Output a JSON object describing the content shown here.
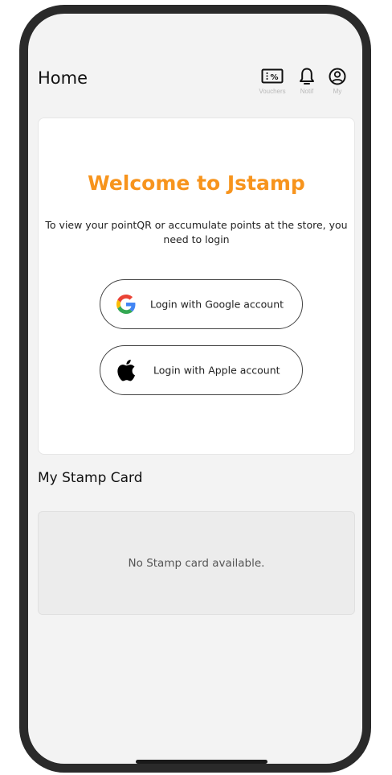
{
  "header": {
    "title": "Home",
    "actions": [
      {
        "label": "Vouchers",
        "icon": "voucher-percent-icon"
      },
      {
        "label": "Notif",
        "icon": "bell-icon"
      },
      {
        "label": "My",
        "icon": "user-circle-icon"
      }
    ]
  },
  "login_card": {
    "title": "Welcome to Jstamp",
    "message": "To view your pointQR or accumulate points at the store, you need to login",
    "google_button": {
      "label": "Login with Google account",
      "icon": "google-g-icon"
    },
    "apple_button": {
      "label": "Login with Apple account",
      "icon": "apple-logo-icon"
    }
  },
  "stamp_section": {
    "title": "My Stamp Card",
    "empty_message": "No Stamp card available."
  },
  "colors": {
    "accent": "#f7941d",
    "background": "#f3f3f3",
    "card": "#ffffff",
    "frame": "#2a2a2a"
  }
}
